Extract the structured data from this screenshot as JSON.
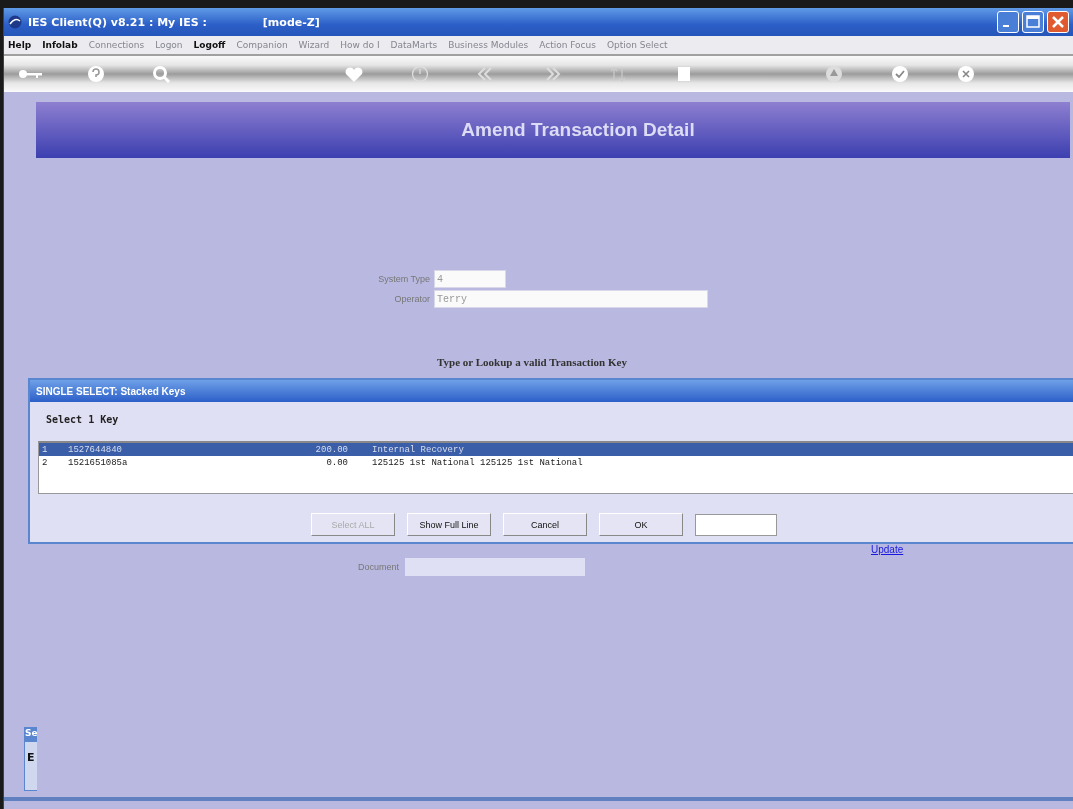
{
  "window": {
    "title": "IES Client(Q) v8.21 : My IES :",
    "mode": "[mode-Z]"
  },
  "menu": [
    {
      "label": "Help",
      "disabled": false
    },
    {
      "label": "Infolab",
      "disabled": false
    },
    {
      "label": "Connections",
      "disabled": true
    },
    {
      "label": "Logon",
      "disabled": true
    },
    {
      "label": "Logoff",
      "disabled": false
    },
    {
      "label": "Companion",
      "disabled": true
    },
    {
      "label": "Wizard",
      "disabled": true
    },
    {
      "label": "How do I",
      "disabled": true
    },
    {
      "label": "DataMarts",
      "disabled": true
    },
    {
      "label": "Business Modules",
      "disabled": true
    },
    {
      "label": "Action Focus",
      "disabled": true
    },
    {
      "label": "Option Select",
      "disabled": true
    }
  ],
  "banner": {
    "title": "Amend Transaction Detail"
  },
  "fields": [
    {
      "label": "System Type",
      "value": "4"
    },
    {
      "label": "Operator",
      "value": "Terry"
    }
  ],
  "instruction": "Type or Lookup a valid Transaction Key",
  "dialog": {
    "title": "SINGLE SELECT: Stacked Keys",
    "heading": "Select 1 Key",
    "rows": [
      {
        "number": "1",
        "key": "1527644840",
        "amount": "200.00",
        "description": "Internal Recovery",
        "selected": true
      },
      {
        "number": "2",
        "key": "1521651085a",
        "amount": "0.00",
        "description": "125125 1st National 125125 1st National",
        "selected": false
      }
    ],
    "buttons": [
      {
        "label": "Select ALL",
        "disabled": true
      },
      {
        "label": "Show Full Line",
        "disabled": false
      },
      {
        "label": "Cancel",
        "disabled": false
      },
      {
        "label": "OK",
        "disabled": false
      }
    ]
  },
  "update_link": "Update",
  "document": {
    "label": "Document"
  },
  "side_window": {
    "title": "Se",
    "text": "E"
  }
}
